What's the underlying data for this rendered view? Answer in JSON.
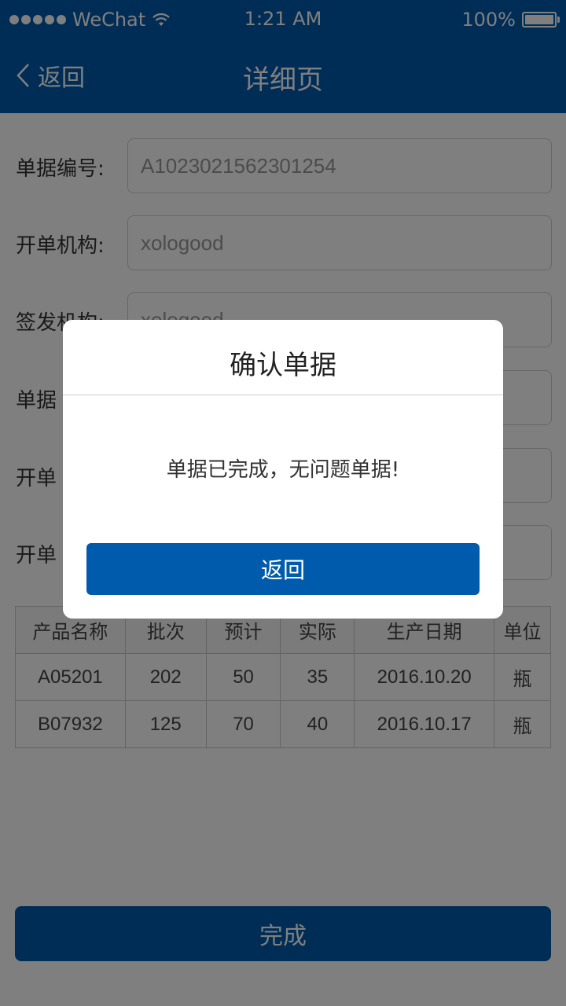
{
  "status_bar": {
    "carrier": "WeChat",
    "time": "1:21 AM",
    "battery": "100%"
  },
  "navbar": {
    "back_label": "返回",
    "title": "详细页"
  },
  "form": {
    "rows": [
      {
        "label": "单据编号:",
        "value": "A1023021562301254"
      },
      {
        "label": "开单机构:",
        "value": "xologood"
      },
      {
        "label": "签发机构:",
        "value": "xologood"
      },
      {
        "label": "单据",
        "value": ""
      },
      {
        "label": "开单",
        "value": ""
      },
      {
        "label": "开单",
        "value": ""
      }
    ]
  },
  "table": {
    "headers": [
      "产品名称",
      "批次",
      "预计",
      "实际",
      "生产日期",
      "单位"
    ],
    "rows": [
      [
        "A05201",
        "202",
        "50",
        "35",
        "2016.10.20",
        "瓶"
      ],
      [
        "B07932",
        "125",
        "70",
        "40",
        "2016.10.17",
        "瓶"
      ]
    ]
  },
  "complete_button": "完成",
  "dialog": {
    "title": "确认单据",
    "message": "单据已完成，无问题单据!",
    "button": "返回"
  },
  "colors": {
    "primary": "#005bac",
    "overlay": "rgba(0,0,0,0.5)"
  }
}
